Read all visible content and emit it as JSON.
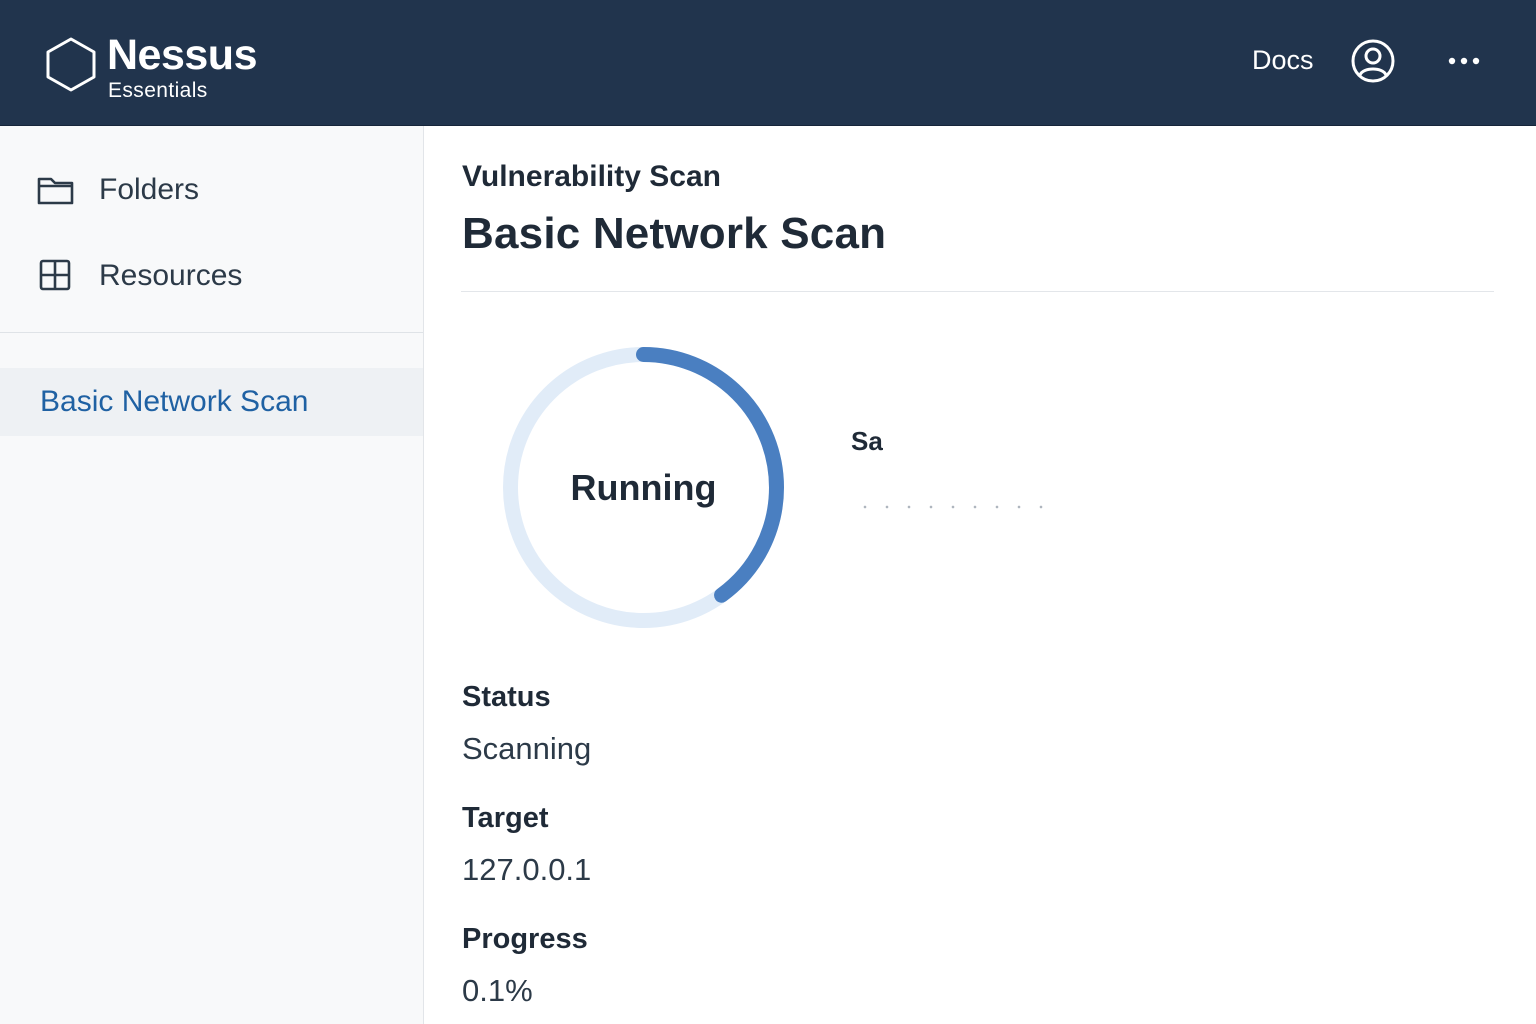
{
  "app": {
    "brand_name": "Nessus",
    "brand_sub": "Essentials"
  },
  "header": {
    "docs_label": "Docs",
    "user_icon": "user-circle-icon",
    "more_icon": "more-horizontal-icon"
  },
  "sidebar": {
    "nav": [
      {
        "label": "Folders",
        "icon": "folder-icon"
      },
      {
        "label": "Resources",
        "icon": "grid-icon"
      }
    ],
    "scans": [
      {
        "label": "Basic Network Scan",
        "selected": true
      }
    ]
  },
  "main": {
    "eyebrow": "Vulnerability Scan",
    "title": "Basic Network Scan",
    "ring": {
      "label": "Running",
      "fill_fraction": 0.4
    },
    "side_info": {
      "title": "Sa"
    },
    "fields": [
      {
        "label": "Status",
        "value": "Scanning"
      },
      {
        "label": "Target",
        "value": "127.0.0.1"
      },
      {
        "label": "Progress",
        "value": "0.1%"
      }
    ]
  },
  "colors": {
    "topbar": "#21344d",
    "accent": "#4a7fc1",
    "ring_track": "#e1ecf8",
    "link": "#1f61a3"
  }
}
